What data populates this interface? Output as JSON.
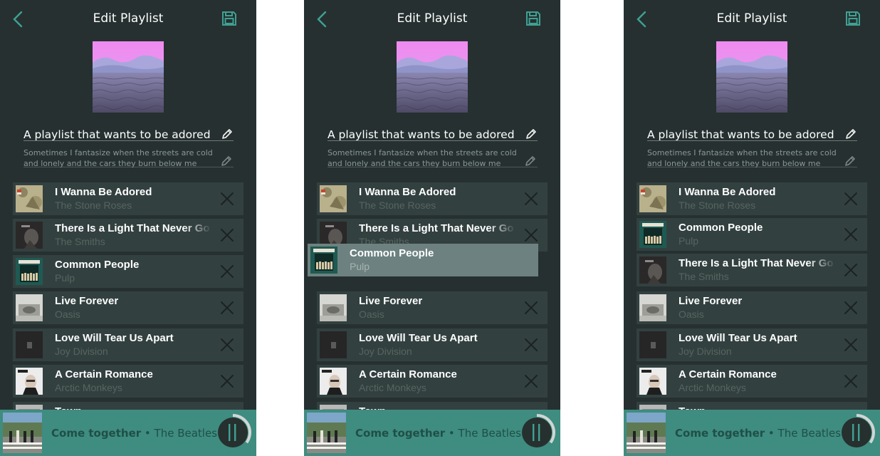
{
  "panels": [
    {
      "title": "Edit Playlist",
      "playlist_name": "A playlist that wants to be adored",
      "description": "Sometimes I fantasize when the streets are cold and lonely and the cars they burn below me",
      "tracks": [
        {
          "title": "I Wanna Be Adored",
          "artist": "The Stone Roses"
        },
        {
          "title": "There Is a Light That Never Go",
          "artist": "The Smiths"
        },
        {
          "title": "Common People",
          "artist": "Pulp"
        },
        {
          "title": "Live Forever",
          "artist": "Oasis"
        },
        {
          "title": "Love Will Tear Us Apart",
          "artist": "Joy Division"
        },
        {
          "title": "A Certain Romance",
          "artist": "Arctic Monkeys"
        },
        {
          "title": "Town",
          "artist": ""
        }
      ],
      "now_playing": {
        "song": "Come together",
        "separator": " • ",
        "artist": "The Beatles",
        "progress": 0.35
      }
    },
    {
      "title": "Edit Playlist",
      "playlist_name": "A playlist that wants to be adored",
      "description": "Sometimes I fantasize when the streets are cold and lonely and the cars they burn below me",
      "tracks": [
        {
          "title": "I Wanna Be Adored",
          "artist": "The Stone Roses"
        },
        {
          "title": "There Is a Light That Never Go",
          "artist": "The Smiths"
        },
        {
          "title": "Live Forever",
          "artist": "Oasis"
        },
        {
          "title": "Love Will Tear Us Apart",
          "artist": "Joy Division"
        },
        {
          "title": "A Certain Romance",
          "artist": "Arctic Monkeys"
        },
        {
          "title": "Town",
          "artist": ""
        }
      ],
      "dragging": {
        "title": "Common People",
        "artist": "Pulp"
      },
      "now_playing": {
        "song": "Come together",
        "separator": " • ",
        "artist": "The Beatles",
        "progress": 0.35
      }
    },
    {
      "title": "Edit Playlist",
      "playlist_name": "A playlist that wants to be adored",
      "description": "Sometimes I fantasize when the streets are cold and lonely and the cars they burn below me",
      "tracks": [
        {
          "title": "I Wanna Be Adored",
          "artist": "The Stone Roses"
        },
        {
          "title": "Common People",
          "artist": "Pulp"
        },
        {
          "title": "There Is a Light That Never Go",
          "artist": "The Smiths"
        },
        {
          "title": "Live Forever",
          "artist": "Oasis"
        },
        {
          "title": "Love Will Tear Us Apart",
          "artist": "Joy Division"
        },
        {
          "title": "A Certain Romance",
          "artist": "Arctic Monkeys"
        },
        {
          "title": "Town",
          "artist": ""
        }
      ],
      "now_playing": {
        "song": "Come together",
        "separator": " • ",
        "artist": "The Beatles",
        "progress": 0.35
      }
    }
  ],
  "icons": {
    "back": "chevron-left-icon",
    "save": "floppy-disk-icon",
    "edit": "pencil-icon",
    "remove": "close-icon",
    "pause": "pause-icon"
  },
  "colors": {
    "background": "#263030",
    "row": "#334040",
    "accent": "#3f8c80",
    "drag_row": "#6d8280",
    "artist_text": "#56655f"
  }
}
